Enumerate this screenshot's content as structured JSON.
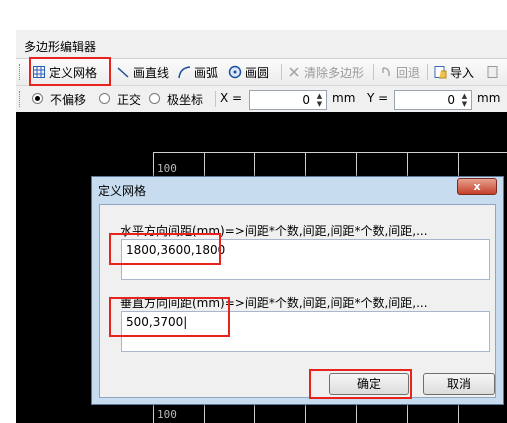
{
  "window": {
    "title": "多边形编辑器"
  },
  "toolbar": {
    "define_grid": "定义网格",
    "draw_line": "画直线",
    "draw_arc": "画弧",
    "draw_circle": "画圆",
    "clear_polygon": "清除多边形",
    "undo": "回退",
    "import": "导入"
  },
  "options": {
    "no_offset": "不偏移",
    "ortho": "正交",
    "polar": "极坐标",
    "x_label": "X =",
    "x_value": "0",
    "x_unit": "mm",
    "y_label": "Y =",
    "y_value": "0",
    "y_unit": "mm"
  },
  "canvas": {
    "label_top": "100",
    "label_bottom": "100"
  },
  "dialog": {
    "title": "定义网格",
    "close": "x",
    "horizontal_label": "水平方向间距(mm)=>间距*个数,间距,间距*个数,间距,...",
    "horizontal_value": "1800,3600,1800",
    "vertical_label": "垂直方向间距(mm)=>间距*个数,间距,间距*个数,间距,...",
    "vertical_value": "500,3700",
    "ok": "确定",
    "cancel": "取消"
  },
  "colors": {
    "highlight": "#e8231e",
    "canvas_bg": "#000000",
    "grid": "#cfcfcf"
  }
}
